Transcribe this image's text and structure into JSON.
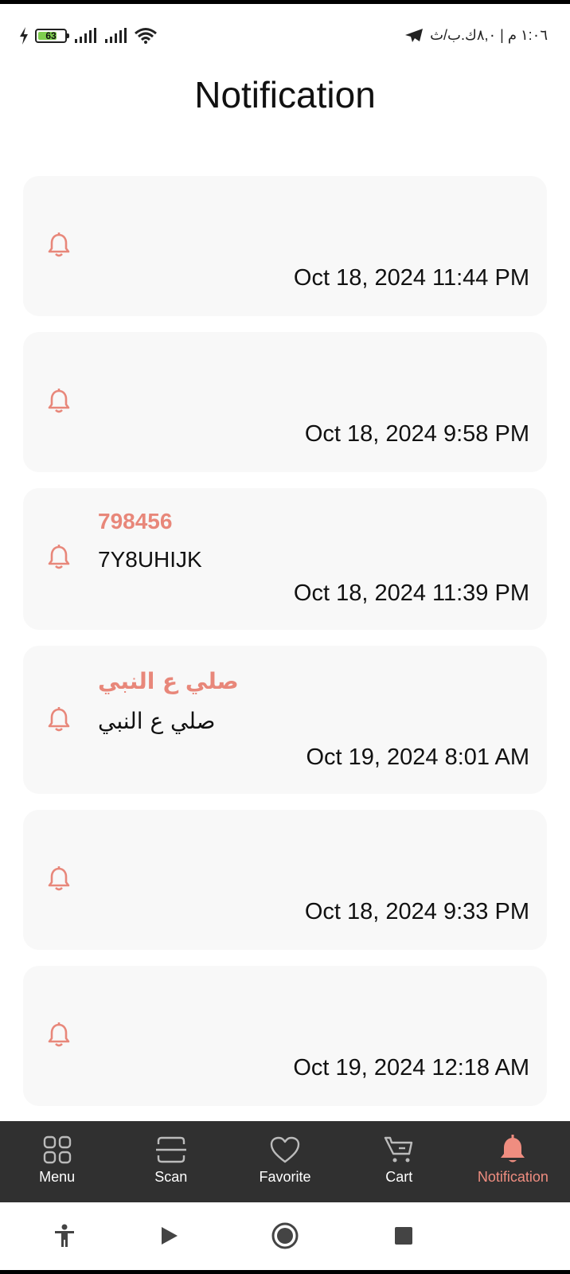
{
  "status_bar": {
    "battery": "63",
    "time_text": "١:٠٦ م | ٨,٠ك.ب/ث"
  },
  "header": {
    "title": "Notification"
  },
  "notifications": [
    {
      "title": "",
      "body": "",
      "date": "Oct 18, 2024 11:44 PM"
    },
    {
      "title": "",
      "body": "",
      "date": "Oct 18, 2024 9:58 PM"
    },
    {
      "title": "798456",
      "body": "7Y8UHIJK",
      "date": "Oct 18, 2024 11:39 PM"
    },
    {
      "title": "صلي ع النبي",
      "body": "صلي ع النبي",
      "date": "Oct 19, 2024 8:01 AM"
    },
    {
      "title": "",
      "body": "",
      "date": "Oct 18, 2024 9:33 PM"
    },
    {
      "title": "",
      "body": "",
      "date": "Oct 19, 2024 12:18 AM"
    }
  ],
  "bottom_nav": {
    "items": [
      {
        "label": "Menu",
        "icon": "grid-icon"
      },
      {
        "label": "Scan",
        "icon": "scan-icon"
      },
      {
        "label": "Favorite",
        "icon": "heart-icon"
      },
      {
        "label": "Cart",
        "icon": "cart-icon"
      },
      {
        "label": "Notification",
        "icon": "bell-icon",
        "active": true
      }
    ]
  },
  "colors": {
    "accent": "#e8877a",
    "card_bg": "#f8f8f8",
    "nav_bg": "#303030",
    "nav_active": "#ef8d80"
  }
}
